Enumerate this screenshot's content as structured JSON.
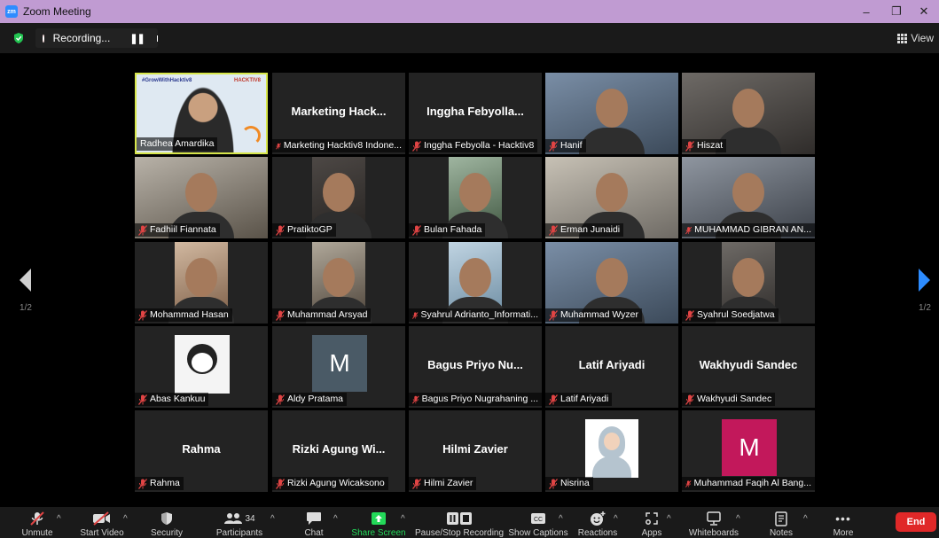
{
  "window": {
    "title": "Zoom Meeting",
    "app_icon": "zm"
  },
  "recording": {
    "label": "Recording..."
  },
  "view": {
    "label": "View"
  },
  "pager": {
    "left": "1/2",
    "right": "1/2"
  },
  "participants": [
    {
      "name": "Radhea Amardika",
      "big": "",
      "video": "share",
      "muted": false
    },
    {
      "name": "Marketing Hacktiv8 Indone...",
      "big": "Marketing Hack...",
      "video": "none",
      "muted": true
    },
    {
      "name": "Inggha Febyolla - Hacktiv8",
      "big": "Inggha Febyolla...",
      "video": "none",
      "muted": true
    },
    {
      "name": "Hanif",
      "big": "",
      "video": "camera",
      "muted": true
    },
    {
      "name": "Hiszat",
      "big": "",
      "video": "camera",
      "muted": true
    },
    {
      "name": "Fadhiil Fiannata",
      "big": "",
      "video": "camera",
      "muted": true
    },
    {
      "name": "PratiktoGP",
      "big": "",
      "video": "camera",
      "muted": true
    },
    {
      "name": "Bulan Fahada",
      "big": "",
      "video": "camera",
      "muted": true
    },
    {
      "name": "Erman Junaidi",
      "big": "",
      "video": "camera",
      "muted": true
    },
    {
      "name": "MUHAMMAD GIBRAN AN...",
      "big": "",
      "video": "camera",
      "muted": true
    },
    {
      "name": "Mohammad Hasan",
      "big": "",
      "video": "camera",
      "muted": true
    },
    {
      "name": "Muhammad Arsyad",
      "big": "",
      "video": "camera",
      "muted": true
    },
    {
      "name": "Syahrul Adrianto_Informati...",
      "big": "",
      "video": "camera",
      "muted": true
    },
    {
      "name": "Muhammad Wyzer",
      "big": "",
      "video": "camera",
      "muted": true
    },
    {
      "name": "Syahrul Soedjatwa",
      "big": "",
      "video": "camera",
      "muted": true
    },
    {
      "name": "Abas Kankuu",
      "big": "",
      "video": "avatar",
      "muted": true
    },
    {
      "name": "Aldy Pratama",
      "big": "",
      "video": "letter",
      "letter": "M",
      "letter_bg": "#4a5a66",
      "muted": true
    },
    {
      "name": "Bagus Priyo Nugrahaning ...",
      "big": "Bagus Priyo Nu...",
      "video": "none",
      "muted": true
    },
    {
      "name": "Latif Ariyadi",
      "big": "Latif Ariyadi",
      "video": "none",
      "muted": true
    },
    {
      "name": "Wakhyudi Sandec",
      "big": "Wakhyudi Sandec",
      "video": "none",
      "muted": true
    },
    {
      "name": "Rahma",
      "big": "Rahma",
      "video": "none",
      "muted": true
    },
    {
      "name": "Rizki Agung Wicaksono",
      "big": "Rizki Agung Wi...",
      "video": "none",
      "muted": true
    },
    {
      "name": "Hilmi Zavier",
      "big": "Hilmi Zavier",
      "video": "none",
      "muted": true
    },
    {
      "name": "Nisrina",
      "big": "",
      "video": "photo",
      "muted": true
    },
    {
      "name": "Muhammad Faqih Al Bang...",
      "big": "",
      "video": "letter",
      "letter": "M",
      "letter_bg": "#c2185b",
      "muted": true
    }
  ],
  "share_banner": {
    "hashtag": "#GrowWithHacktiv8",
    "brand": "HACKTIV8"
  },
  "toolbar": {
    "unmute": "Unmute",
    "start_video": "Start Video",
    "security": "Security",
    "participants": "Participants",
    "participants_count": "34",
    "chat": "Chat",
    "share_screen": "Share Screen",
    "pause_stop_recording": "Pause/Stop Recording",
    "show_captions": "Show Captions",
    "reactions": "Reactions",
    "apps": "Apps",
    "whiteboards": "Whiteboards",
    "notes": "Notes",
    "more": "More",
    "end": "End"
  },
  "colors": {
    "titlebar": "#c09bd2",
    "share_green": "#23d959",
    "end_red": "#e02828",
    "mute_red": "#e04444",
    "accent_blue": "#2d8cff"
  }
}
